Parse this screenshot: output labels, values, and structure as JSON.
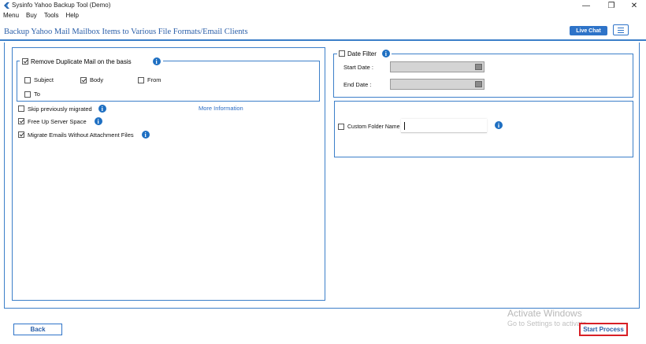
{
  "window": {
    "title": "Sysinfo Yahoo Backup Tool (Demo)",
    "minimize": "—",
    "maximize": "❐",
    "close": "✕"
  },
  "menu": [
    "Menu",
    "Buy",
    "Tools",
    "Help"
  ],
  "header": {
    "title": "Backup Yahoo Mail Mailbox Items to Various File Formats/Email Clients",
    "live_chat": "Live Chat",
    "menu_icon": "hamburger-icon"
  },
  "duplicate": {
    "label": "Remove Duplicate Mail on the basis",
    "checked": true,
    "options": [
      {
        "label": "Subject",
        "checked": false
      },
      {
        "label": "Body",
        "checked": true
      },
      {
        "label": "From",
        "checked": false
      },
      {
        "label": "To",
        "checked": false
      }
    ]
  },
  "options": {
    "skip": {
      "label": "Skip previously migrated",
      "checked": false
    },
    "more_info": "More Information",
    "free_space": {
      "label": "Free Up Server Space",
      "checked": true
    },
    "no_attachments": {
      "label": "Migrate Emails Without Attachment Files",
      "checked": true
    }
  },
  "date_filter": {
    "label": "Date Filter",
    "checked": false,
    "start_label": "Start Date :",
    "end_label": "End Date :"
  },
  "custom_folder": {
    "label": "Custom Folder Name",
    "checked": false,
    "value": ""
  },
  "info_glyph": "i",
  "footer": {
    "back": "Back",
    "start": "Start Process"
  },
  "watermark": {
    "line1": "Activate Windows",
    "line2": "Go to Settings to activate"
  },
  "colors": {
    "accent": "#2e73c8",
    "border": "#3c7fc9",
    "highlight": "#d81f26"
  }
}
